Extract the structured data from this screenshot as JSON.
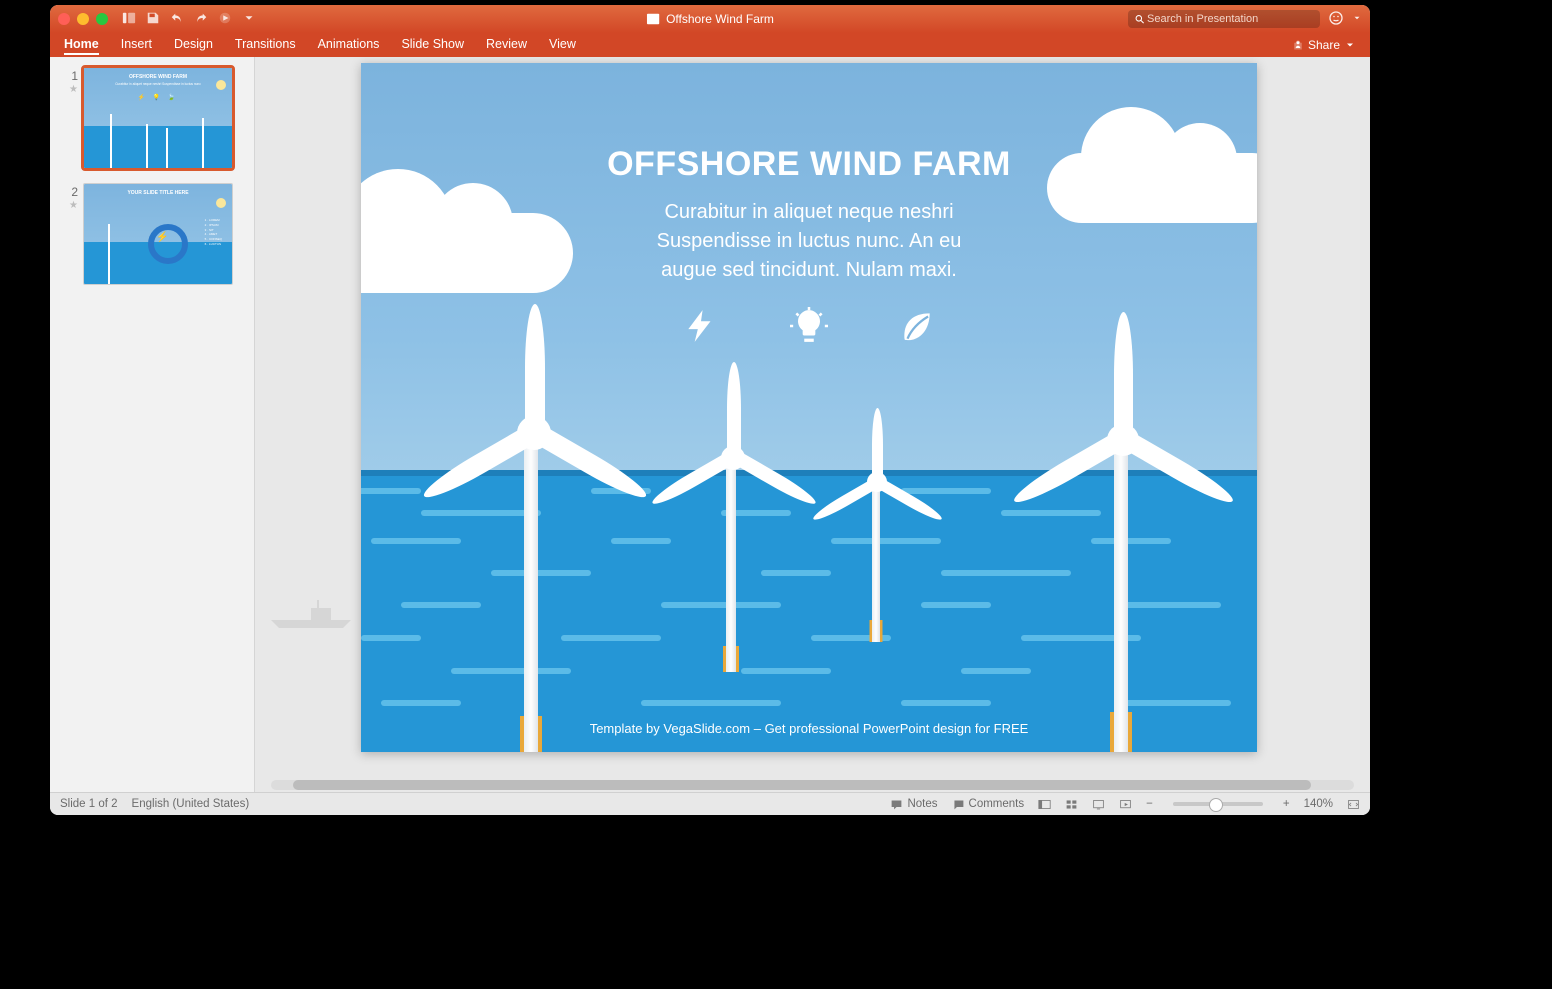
{
  "titlebar": {
    "document_title": "Offshore Wind Farm"
  },
  "search": {
    "placeholder": "Search in Presentation"
  },
  "ribbon": {
    "tabs": {
      "0": {
        "label": "Home"
      },
      "1": {
        "label": "Insert"
      },
      "2": {
        "label": "Design"
      },
      "3": {
        "label": "Transitions"
      },
      "4": {
        "label": "Animations"
      },
      "5": {
        "label": "Slide Show"
      },
      "6": {
        "label": "Review"
      },
      "7": {
        "label": "View"
      }
    },
    "share_label": "Share"
  },
  "thumbnails": {
    "0": {
      "number": "1"
    },
    "1": {
      "number": "2"
    }
  },
  "slide": {
    "title": "OFFSHORE WIND FARM",
    "body_line1": "Curabitur in aliquet neque neshri",
    "body_line2": "Suspendisse in luctus nunc. An eu",
    "body_line3": "augue sed tincidunt. Nulam maxi.",
    "credit": "Template by VegaSlide.com – Get professional PowerPoint design for FREE"
  },
  "slide2": {
    "title": "YOUR SLIDE TITLE HERE"
  },
  "status": {
    "slide_info": "Slide 1 of 2",
    "language": "English (United States)",
    "notes_label": "Notes",
    "comments_label": "Comments",
    "zoom_value": "140%",
    "minus": "−",
    "plus": "+"
  },
  "colors": {
    "accent": "#d24726"
  }
}
